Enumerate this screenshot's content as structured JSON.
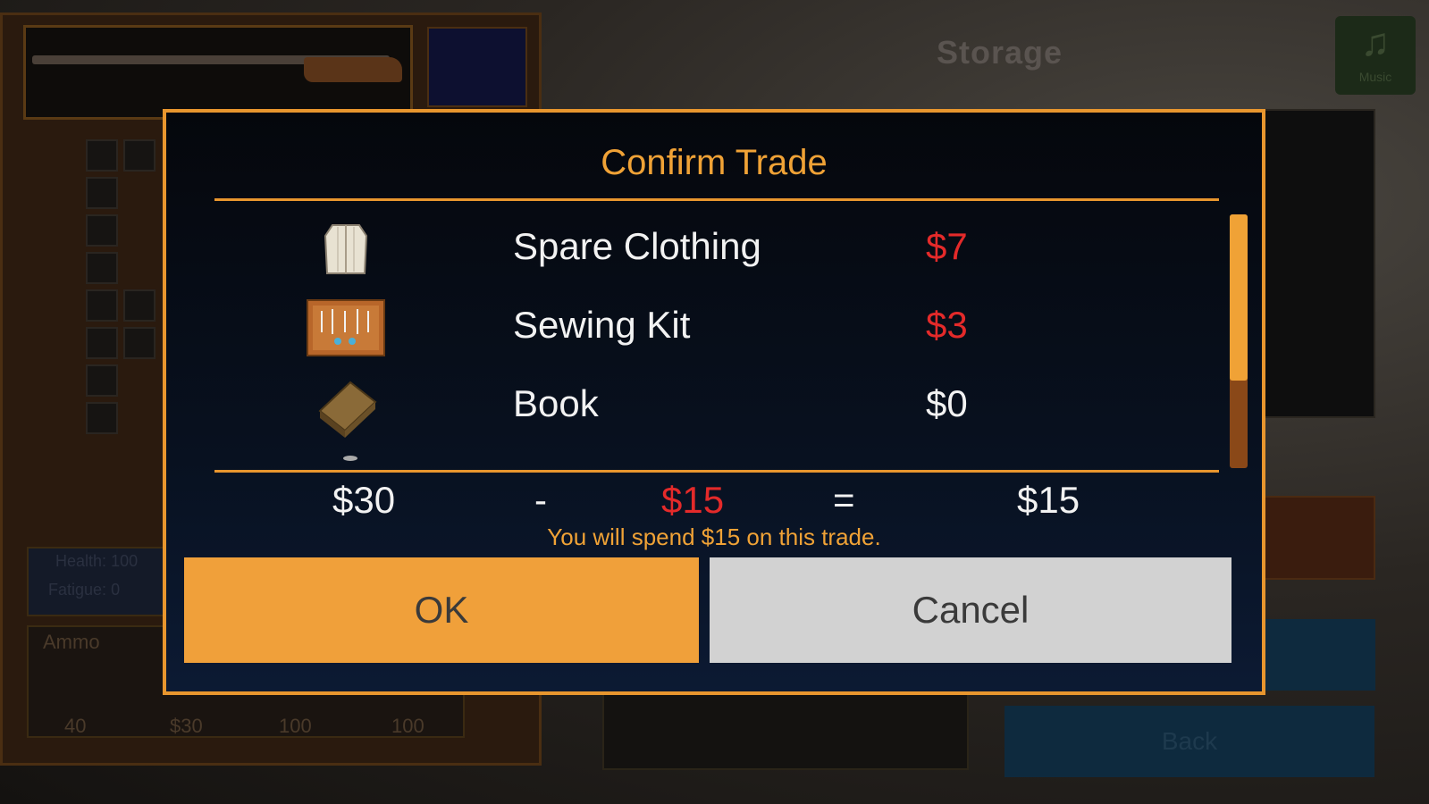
{
  "background": {
    "storage_title": "Storage",
    "music_label": "Music",
    "music_icon": "music-note-icon",
    "back_label": "Back",
    "ammo_label": "Ammo",
    "ammo_counts": [
      "40",
      "$30",
      "100",
      "100"
    ],
    "stats": {
      "health_label": "Health:",
      "health_value": "100",
      "fatigue_label": "Fatigue:",
      "fatigue_value": "0"
    }
  },
  "dialog": {
    "title": "Confirm Trade",
    "items": [
      {
        "icon": "shirt-icon",
        "name": "Spare Clothing",
        "price": "$7",
        "price_color": "#e42a2a"
      },
      {
        "icon": "sewing-kit-icon",
        "name": "Sewing Kit",
        "price": "$3",
        "price_color": "#e42a2a"
      },
      {
        "icon": "book-icon",
        "name": "Book",
        "price": "$0",
        "price_color": "#f2f2f2"
      }
    ],
    "summary": {
      "have": "$30",
      "minus": "-",
      "cost": "$15",
      "equals": "=",
      "remaining": "$15"
    },
    "message": "You will spend $15 on this trade.",
    "ok_label": "OK",
    "cancel_label": "Cancel",
    "scroll_position": 0.0
  },
  "colors": {
    "accent": "#f0a236",
    "cost_red": "#e42a2a",
    "ok_bg": "#f0a03a",
    "cancel_bg": "#d2d2d2"
  }
}
